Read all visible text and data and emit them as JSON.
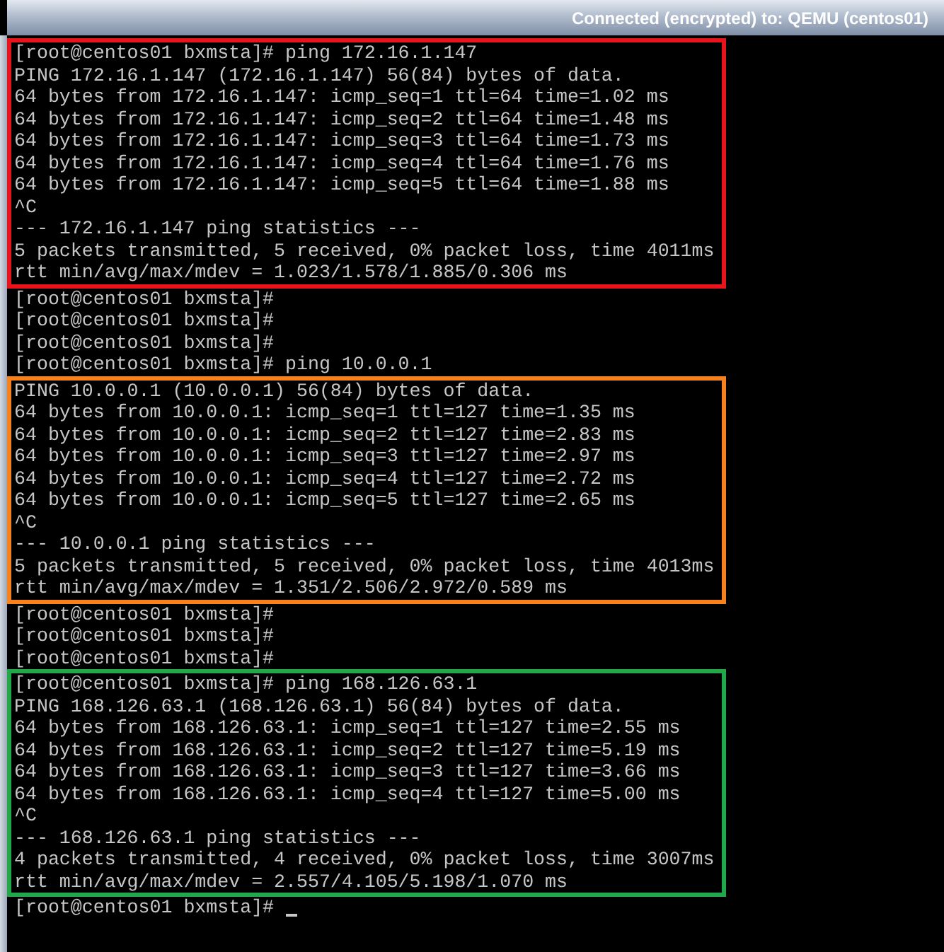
{
  "title_bar": {
    "title": "Connected (encrypted) to: QEMU (centos01)"
  },
  "blocks": [
    {
      "kind": "highlight",
      "color": "#e8141c",
      "lines": [
        "[root@centos01 bxmsta]# ping 172.16.1.147",
        "PING 172.16.1.147 (172.16.1.147) 56(84) bytes of data.",
        "64 bytes from 172.16.1.147: icmp_seq=1 ttl=64 time=1.02 ms",
        "64 bytes from 172.16.1.147: icmp_seq=2 ttl=64 time=1.48 ms",
        "64 bytes from 172.16.1.147: icmp_seq=3 ttl=64 time=1.73 ms",
        "64 bytes from 172.16.1.147: icmp_seq=4 ttl=64 time=1.76 ms",
        "64 bytes from 172.16.1.147: icmp_seq=5 ttl=64 time=1.88 ms",
        "^C",
        "--- 172.16.1.147 ping statistics ---",
        "5 packets transmitted, 5 received, 0% packet loss, time 4011ms",
        "rtt min/avg/max/mdev = 1.023/1.578/1.885/0.306 ms"
      ]
    },
    {
      "kind": "plain",
      "lines": [
        "[root@centos01 bxmsta]#",
        "[root@centos01 bxmsta]#",
        "[root@centos01 bxmsta]#",
        "[root@centos01 bxmsta]# ping 10.0.0.1"
      ]
    },
    {
      "kind": "highlight",
      "color": "#f5821f",
      "lines": [
        "PING 10.0.0.1 (10.0.0.1) 56(84) bytes of data.",
        "64 bytes from 10.0.0.1: icmp_seq=1 ttl=127 time=1.35 ms",
        "64 bytes from 10.0.0.1: icmp_seq=2 ttl=127 time=2.83 ms",
        "64 bytes from 10.0.0.1: icmp_seq=3 ttl=127 time=2.97 ms",
        "64 bytes from 10.0.0.1: icmp_seq=4 ttl=127 time=2.72 ms",
        "64 bytes from 10.0.0.1: icmp_seq=5 ttl=127 time=2.65 ms",
        "^C",
        "--- 10.0.0.1 ping statistics ---",
        "5 packets transmitted, 5 received, 0% packet loss, time 4013ms",
        "rtt min/avg/max/mdev = 1.351/2.506/2.972/0.589 ms"
      ]
    },
    {
      "kind": "plain",
      "lines": [
        "[root@centos01 bxmsta]#",
        "[root@centos01 bxmsta]#",
        "[root@centos01 bxmsta]#"
      ]
    },
    {
      "kind": "highlight",
      "color": "#21a84a",
      "lines": [
        "[root@centos01 bxmsta]# ping 168.126.63.1",
        "PING 168.126.63.1 (168.126.63.1) 56(84) bytes of data.",
        "64 bytes from 168.126.63.1: icmp_seq=1 ttl=127 time=2.55 ms",
        "64 bytes from 168.126.63.1: icmp_seq=2 ttl=127 time=5.19 ms",
        "64 bytes from 168.126.63.1: icmp_seq=3 ttl=127 time=3.66 ms",
        "64 bytes from 168.126.63.1: icmp_seq=4 ttl=127 time=5.00 ms",
        "^C",
        "--- 168.126.63.1 ping statistics ---",
        "4 packets transmitted, 4 received, 0% packet loss, time 3007ms",
        "rtt min/avg/max/mdev = 2.557/4.105/5.198/1.070 ms"
      ]
    },
    {
      "kind": "prompt",
      "lines": [
        "[root@centos01 bxmsta]#"
      ]
    }
  ]
}
